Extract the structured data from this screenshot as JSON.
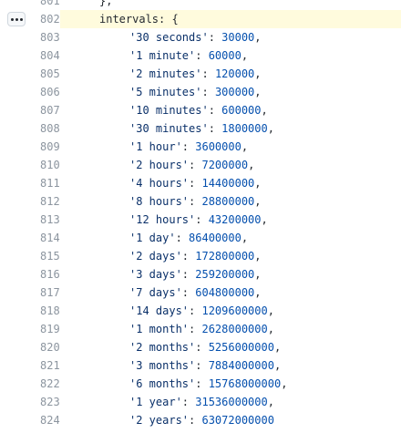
{
  "editor": {
    "top_line": {
      "number": "801",
      "text": "},"
    },
    "highlight_line": {
      "number": "802",
      "key": "intervals",
      "punct": ": {"
    },
    "entries": [
      {
        "number": "803",
        "key": "'30 seconds'",
        "value": "30000",
        "trail": ","
      },
      {
        "number": "804",
        "key": "'1 minute'",
        "value": "60000",
        "trail": ","
      },
      {
        "number": "805",
        "key": "'2 minutes'",
        "value": "120000",
        "trail": ","
      },
      {
        "number": "806",
        "key": "'5 minutes'",
        "value": "300000",
        "trail": ","
      },
      {
        "number": "807",
        "key": "'10 minutes'",
        "value": "600000",
        "trail": ","
      },
      {
        "number": "808",
        "key": "'30 minutes'",
        "value": "1800000",
        "trail": ","
      },
      {
        "number": "809",
        "key": "'1 hour'",
        "value": "3600000",
        "trail": ","
      },
      {
        "number": "810",
        "key": "'2 hours'",
        "value": "7200000",
        "trail": ","
      },
      {
        "number": "811",
        "key": "'4 hours'",
        "value": "14400000",
        "trail": ","
      },
      {
        "number": "812",
        "key": "'8 hours'",
        "value": "28800000",
        "trail": ","
      },
      {
        "number": "813",
        "key": "'12 hours'",
        "value": "43200000",
        "trail": ","
      },
      {
        "number": "814",
        "key": "'1 day'",
        "value": "86400000",
        "trail": ","
      },
      {
        "number": "815",
        "key": "'2 days'",
        "value": "172800000",
        "trail": ","
      },
      {
        "number": "816",
        "key": "'3 days'",
        "value": "259200000",
        "trail": ","
      },
      {
        "number": "817",
        "key": "'7 days'",
        "value": "604800000",
        "trail": ","
      },
      {
        "number": "818",
        "key": "'14 days'",
        "value": "1209600000",
        "trail": ","
      },
      {
        "number": "819",
        "key": "'1 month'",
        "value": "2628000000",
        "trail": ","
      },
      {
        "number": "820",
        "key": "'2 months'",
        "value": "5256000000",
        "trail": ","
      },
      {
        "number": "821",
        "key": "'3 months'",
        "value": "7884000000",
        "trail": ","
      },
      {
        "number": "822",
        "key": "'6 months'",
        "value": "15768000000",
        "trail": ","
      },
      {
        "number": "823",
        "key": "'1 year'",
        "value": "31536000000",
        "trail": ","
      },
      {
        "number": "824",
        "key": "'2 years'",
        "value": "63072000000",
        "trail": ""
      }
    ]
  },
  "icons": {
    "line_actions": "kebab-horizontal-icon"
  },
  "colors": {
    "highlight": "#fffbdd",
    "string": "#0a3069",
    "number": "#0550ae",
    "line_number": "#8c959f"
  }
}
